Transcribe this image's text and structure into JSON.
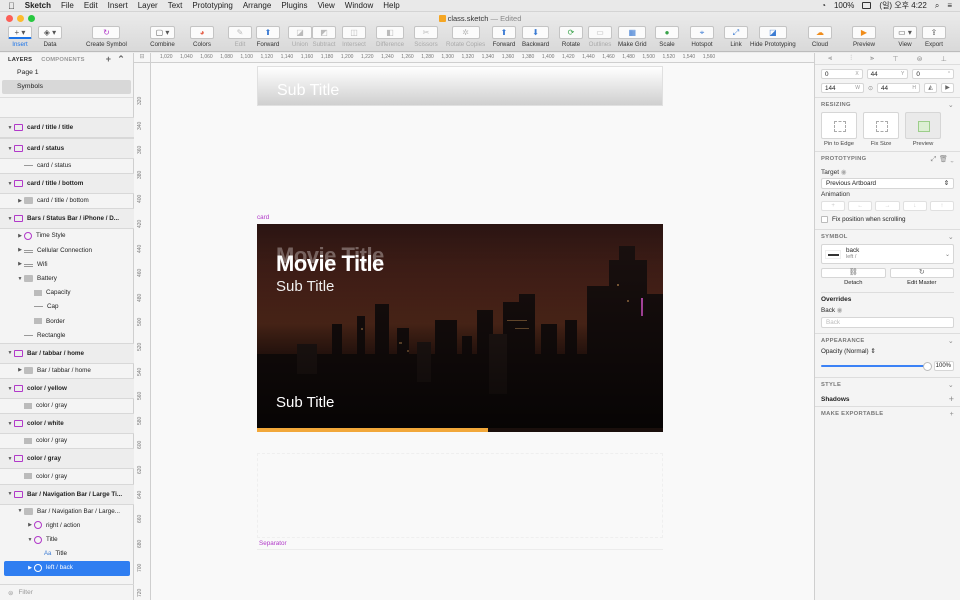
{
  "menubar": {
    "app": "Sketch",
    "items": [
      "File",
      "Edit",
      "Insert",
      "Layer",
      "Text",
      "Prototyping",
      "Arrange",
      "Plugins",
      "View",
      "Window",
      "Help"
    ],
    "battery": "100%",
    "clock": "(일) 오후 4:22"
  },
  "window": {
    "title": "class.sketch",
    "status": "— Edited"
  },
  "toolbar": {
    "insert": "Insert",
    "data": "Data",
    "create_symbol": "Create Symbol",
    "combine": "Combine",
    "colors": "Colors",
    "edit": "Edit",
    "forward": "Forward",
    "union": "Union",
    "subtract": "Subtract",
    "intersect": "Intersect",
    "difference": "Difference",
    "scissors": "Scissors",
    "rotate_copies": "Rotate Copies",
    "forward2": "Forward",
    "backward": "Backward",
    "rotate": "Rotate",
    "outlines": "Outlines",
    "make_grid": "Make Grid",
    "scale": "Scale",
    "hotspot": "Hotspot",
    "link": "Link",
    "hide_prototyping": "Hide Prototyping",
    "cloud": "Cloud",
    "preview": "Preview",
    "view": "View",
    "export": "Export"
  },
  "sidebar": {
    "tab_layers": "LAYERS",
    "tab_components": "COMPONENTS",
    "pages": [
      "Page 1",
      "Symbols"
    ],
    "filter": "Filter",
    "layers": [
      {
        "label": "card / title / title",
        "type": "artboard",
        "group": true
      },
      {
        "label": "card / status",
        "type": "artboard",
        "group": true
      },
      {
        "label": "card / status",
        "type": "line",
        "indent": 1
      },
      {
        "label": "card / title / bottom",
        "type": "artboard",
        "group": true
      },
      {
        "label": "card / title / bottom",
        "type": "folder",
        "indent": 1
      },
      {
        "label": "Bars / Status Bar / iPhone / D...",
        "type": "artboard",
        "group": true
      },
      {
        "label": "Time Style",
        "type": "sym",
        "indent": 1
      },
      {
        "label": "Cellular Connection",
        "type": "bars",
        "indent": 1
      },
      {
        "label": "Wifi",
        "type": "bars",
        "indent": 1
      },
      {
        "label": "Battery",
        "type": "folder",
        "indent": 1,
        "open": true
      },
      {
        "label": "Capacity",
        "type": "rect",
        "indent": 2
      },
      {
        "label": "Cap",
        "type": "line",
        "indent": 2
      },
      {
        "label": "Border",
        "type": "rect",
        "indent": 2
      },
      {
        "label": "Rectangle",
        "type": "line",
        "indent": 1
      },
      {
        "label": "Bar / tabbar / home",
        "type": "artboard",
        "group": true
      },
      {
        "label": "Bar / tabbar / home",
        "type": "folder",
        "indent": 1
      },
      {
        "label": "color / yellow",
        "type": "artboard",
        "group": true
      },
      {
        "label": "color / gray",
        "type": "rect",
        "indent": 1
      },
      {
        "label": "color / white",
        "type": "artboard",
        "group": true
      },
      {
        "label": "color / gray",
        "type": "rect",
        "indent": 1
      },
      {
        "label": "color / gray",
        "type": "artboard",
        "group": true
      },
      {
        "label": "color / gray",
        "type": "rect",
        "indent": 1
      },
      {
        "label": "Bar / Navigation Bar / Large Ti...",
        "type": "artboard",
        "group": true
      },
      {
        "label": "Bar / Navigation Bar / Large...",
        "type": "folder",
        "indent": 1,
        "open": true
      },
      {
        "label": "right / action",
        "type": "sym",
        "indent": 2
      },
      {
        "label": "Title",
        "type": "sym",
        "indent": 2,
        "open": true
      },
      {
        "label": "Title",
        "type": "text",
        "indent": 3
      },
      {
        "label": "left / back",
        "type": "sym",
        "indent": 2,
        "selected": true
      }
    ]
  },
  "rulers": {
    "h": [
      "1,020",
      "1,040",
      "1,060",
      "1,080",
      "1,100",
      "1,120",
      "1,140",
      "1,160",
      "1,180",
      "1,200",
      "1,220",
      "1,240",
      "1,260",
      "1,280",
      "1,300",
      "1,320",
      "1,340",
      "1,360",
      "1,380",
      "1,400",
      "1,420",
      "1,440",
      "1,460",
      "1,480",
      "1,500",
      "1,520",
      "1,540",
      "1,560"
    ],
    "v": [
      "320",
      "340",
      "360",
      "380",
      "400",
      "420",
      "440",
      "460",
      "480",
      "500",
      "520",
      "540",
      "560",
      "580",
      "600",
      "620",
      "640",
      "660",
      "680",
      "700",
      "720"
    ]
  },
  "canvas": {
    "top_subtitle": "Sub Title",
    "card_label": "card",
    "ghost_title": "Movie Title",
    "movie_title": "Movie Title",
    "sub_title_1": "Sub Title",
    "sub_title_2": "Sub Title",
    "progress": 0.57,
    "separator_label": "Separator"
  },
  "inspector": {
    "x": "0",
    "y": "44",
    "rot": "0",
    "w": "144",
    "h": "44",
    "x_l": "X",
    "y_l": "Y",
    "w_l": "W",
    "h_l": "H",
    "resizing": "RESIZING",
    "pin_to_edge": "Pin to Edge",
    "fix_size": "Fix Size",
    "preview": "Preview",
    "prototyping": "PROTOTYPING",
    "target_label": "Target",
    "target_value": "Previous Artboard",
    "animation_label": "Animation",
    "fix_position": "Fix position when scrolling",
    "symbol": "SYMBOL",
    "symbol_name": "back",
    "symbol_path": "left /",
    "detach": "Detach",
    "edit_master": "Edit Master",
    "overrides": "Overrides",
    "override_back_label": "Back",
    "override_back_placeholder": "Back",
    "appearance": "APPEARANCE",
    "opacity_label": "Opacity (Normal)",
    "opacity_value": "100%",
    "style": "STYLE",
    "shadows": "Shadows",
    "make_exportable": "MAKE EXPORTABLE"
  },
  "colors": {
    "accent": "#2f7ef1",
    "symbol": "#b138c9",
    "progress": "#f2a83a"
  }
}
